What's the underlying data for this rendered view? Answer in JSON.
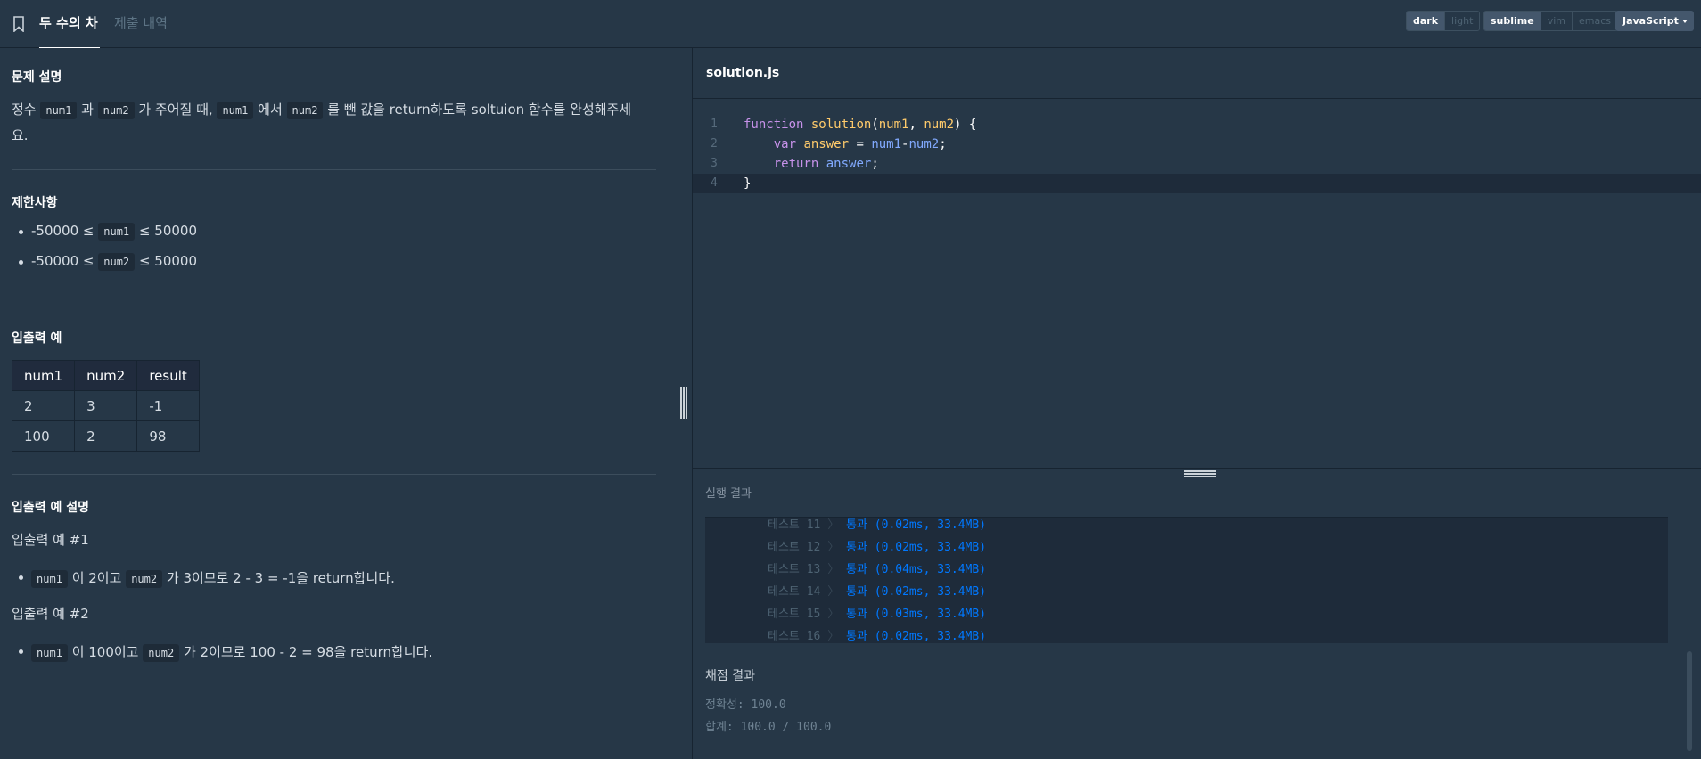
{
  "header": {
    "tabs": [
      {
        "label": "두 수의 차",
        "active": true
      },
      {
        "label": "제출 내역",
        "active": false
      }
    ],
    "theme": [
      "dark",
      "light"
    ],
    "theme_selected": "dark",
    "keymap": [
      "sublime",
      "vim",
      "emacs"
    ],
    "keymap_selected": "sublime",
    "language": "JavaScript"
  },
  "problem": {
    "desc_title": "문제 설명",
    "desc": {
      "t1": "정수",
      "c1": "num1",
      "t2": "과",
      "c2": "num2",
      "t3": "가 주어질 때,",
      "c3": "num1",
      "t4": "에서",
      "c4": "num2",
      "t5": "를 뺀 값을 return하도록 soltuion 함수를 완성해주세",
      "t6": "요."
    },
    "constraints_title": "제한사항",
    "constraints": [
      {
        "pre": "-50000 ≤",
        "code": "num1",
        "post": "≤ 50000"
      },
      {
        "pre": "-50000 ≤",
        "code": "num2",
        "post": "≤ 50000"
      }
    ],
    "io_title": "입출력 예",
    "io_table": {
      "headers": [
        "num1",
        "num2",
        "result"
      ],
      "rows": [
        [
          "2",
          "3",
          "-1"
        ],
        [
          "100",
          "2",
          "98"
        ]
      ]
    },
    "io_explain_title": "입출력 예 설명",
    "examples": [
      {
        "title": "입출력 예 #1",
        "c1": "num1",
        "t1": "이 2이고",
        "c2": "num2",
        "t2": "가 3이므로 2 - 3 = -1을 return합니다."
      },
      {
        "title": "입출력 예 #2",
        "c1": "num1",
        "t1": "이 100이고",
        "c2": "num2",
        "t2": "가 2이므로 100 - 2 = 98을 return합니다."
      }
    ]
  },
  "editor": {
    "filename": "solution.js",
    "line_numbers": [
      "1",
      "2",
      "3",
      "4"
    ],
    "code": {
      "l1_kw": "function",
      "l1_fn": "solution",
      "l1_p1": "num1",
      "l1_p2": "num2",
      "l2_kw": "var",
      "l2_var": "answer",
      "l2_a": "num1",
      "l2_b": "num2",
      "l3_kw": "return",
      "l3_var": "answer",
      "l4": "}"
    }
  },
  "results": {
    "title": "실행 결과",
    "tests": [
      {
        "label": "테스트 11",
        "status": "통과",
        "detail": "(0.02ms, 33.4MB)"
      },
      {
        "label": "테스트 12",
        "status": "통과",
        "detail": "(0.02ms, 33.4MB)"
      },
      {
        "label": "테스트 13",
        "status": "통과",
        "detail": "(0.04ms, 33.4MB)"
      },
      {
        "label": "테스트 14",
        "status": "통과",
        "detail": "(0.02ms, 33.4MB)"
      },
      {
        "label": "테스트 15",
        "status": "통과",
        "detail": "(0.03ms, 33.4MB)"
      },
      {
        "label": "테스트 16",
        "status": "통과",
        "detail": "(0.02ms, 33.4MB)"
      }
    ],
    "separator": "〉",
    "grading_title": "채점 결과",
    "accuracy": "정확성: 100.0",
    "total": "합계: 100.0 / 100.0"
  },
  "colors": {
    "background": "#263747",
    "accent": "#0078ff",
    "text": "#d6dde4"
  }
}
